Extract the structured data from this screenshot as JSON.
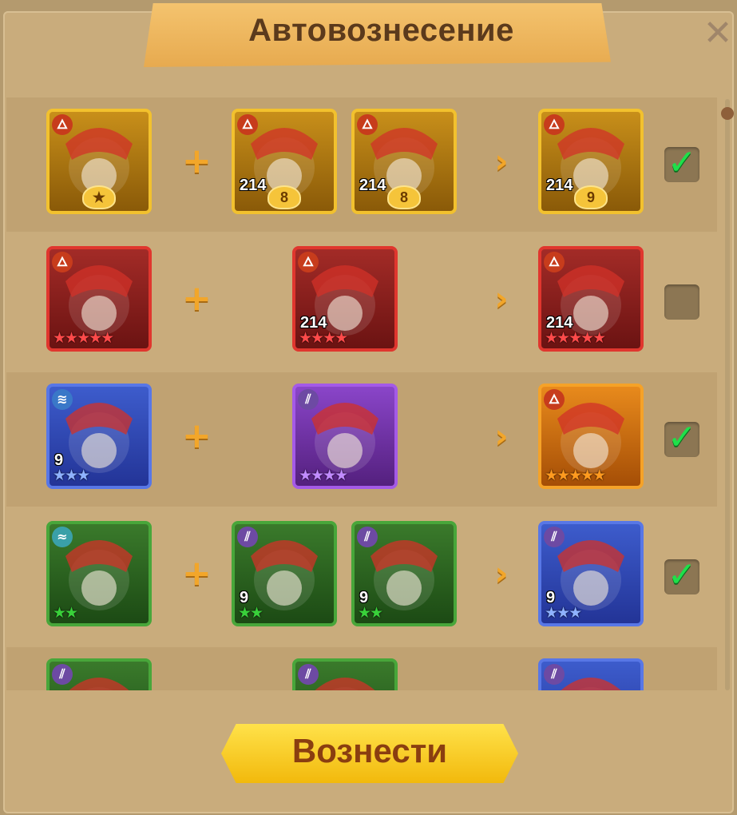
{
  "window": {
    "title": "Автовознесение",
    "close_icon": "close-icon"
  },
  "rows": [
    {
      "checked": true,
      "base": {
        "frame": "gold",
        "element": "fire",
        "level": "",
        "stars": "",
        "badge": ""
      },
      "materials": [
        {
          "frame": "gold",
          "element": "fire",
          "level": "214",
          "stars": "",
          "badge": "8"
        },
        {
          "frame": "gold",
          "element": "fire",
          "level": "214",
          "stars": "",
          "badge": "8"
        }
      ],
      "result": {
        "frame": "gold",
        "element": "fire",
        "level": "214",
        "stars": "",
        "badge": "9"
      }
    },
    {
      "checked": false,
      "base": {
        "frame": "red",
        "element": "fire",
        "level": "",
        "stars": "★★★★★",
        "badge": ""
      },
      "materials": [
        {
          "frame": "red",
          "element": "fire",
          "level": "214",
          "stars": "★★★★",
          "badge": ""
        }
      ],
      "result": {
        "frame": "red",
        "element": "fire",
        "level": "214",
        "stars": "★★★★★",
        "badge": ""
      }
    },
    {
      "checked": true,
      "base": {
        "frame": "blue",
        "element": "water",
        "level": "9",
        "stars": "★★★",
        "badge": ""
      },
      "materials": [
        {
          "frame": "purple",
          "element": "slash",
          "level": "",
          "stars": "★★★★",
          "badge": ""
        }
      ],
      "result": {
        "frame": "orange",
        "element": "fire",
        "level": "",
        "stars": "★★★★★",
        "badge": ""
      }
    },
    {
      "checked": true,
      "base": {
        "frame": "green",
        "element": "wind",
        "level": "",
        "stars": "★★",
        "badge": ""
      },
      "materials": [
        {
          "frame": "green",
          "element": "slash",
          "level": "9",
          "stars": "★★",
          "badge": ""
        },
        {
          "frame": "green",
          "element": "slash",
          "level": "9",
          "stars": "★★",
          "badge": ""
        }
      ],
      "result": {
        "frame": "blue",
        "element": "slash",
        "level": "9",
        "stars": "★★★",
        "badge": ""
      }
    },
    {
      "checked": false,
      "base": {
        "frame": "green",
        "element": "slash",
        "level": "",
        "stars": "",
        "badge": ""
      },
      "materials": [
        {
          "frame": "green",
          "element": "slash",
          "level": "",
          "stars": "",
          "badge": ""
        }
      ],
      "result": {
        "frame": "blue",
        "element": "slash",
        "level": "",
        "stars": "",
        "badge": ""
      }
    }
  ],
  "ascend_button": {
    "label": "Вознести"
  },
  "colors": {
    "accent": "#f2a62a",
    "check": "#1ee04a",
    "button": "#f2b90c"
  }
}
